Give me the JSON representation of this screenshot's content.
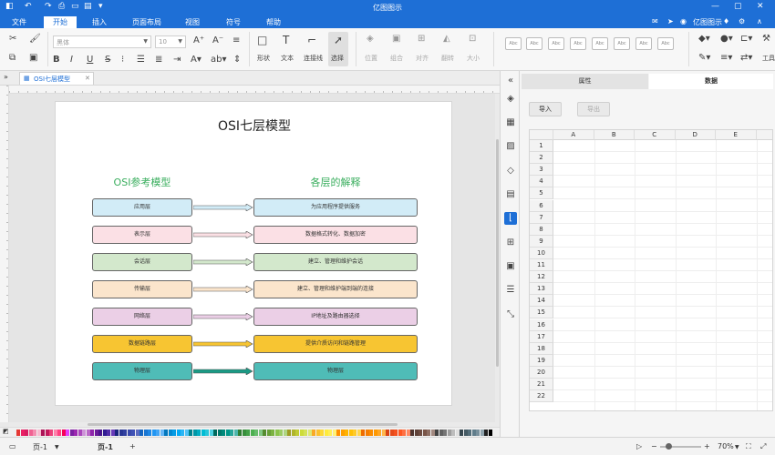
{
  "window": {
    "title": "亿图图示"
  },
  "menu": {
    "items": [
      "文件",
      "开始",
      "插入",
      "页面布局",
      "视图",
      "符号",
      "帮助"
    ],
    "active_index": 1
  },
  "account": {
    "name": "亿图图示"
  },
  "ribbon": {
    "font_name": "黑体",
    "font_size": "10",
    "tools": {
      "shape": "形状",
      "text": "文本",
      "connector": "连接线",
      "select": "选择"
    },
    "arrange": {
      "position": "位置",
      "group": "组合",
      "align": "对齐",
      "flip": "翻转",
      "size": "大小"
    },
    "style_sample": "Abc",
    "tools_group": "工具"
  },
  "document": {
    "tab_label": "OSI七层模型"
  },
  "diagram": {
    "title": "OSI七层模型",
    "left_header": "OSI参考模型",
    "right_header": "各层的解释",
    "rows": [
      {
        "layer": "应用层",
        "desc": "为应用程序提供服务",
        "fill": "#d2ecf7",
        "arrow": "#d2ecf7"
      },
      {
        "layer": "表示层",
        "desc": "数据格式转化、数据加密",
        "fill": "#fbe0e5",
        "arrow": "#fbe0e5"
      },
      {
        "layer": "会话层",
        "desc": "建立、管理和维护会话",
        "fill": "#d3e8cc",
        "arrow": "#d3e8cc"
      },
      {
        "layer": "传输层",
        "desc": "建立、管理和维护端到端的连接",
        "fill": "#fbe5cc",
        "arrow": "#fbe5cc"
      },
      {
        "layer": "网络层",
        "desc": "IP地址及路由器选择",
        "fill": "#ebcfe6",
        "arrow": "#ebcfe6"
      },
      {
        "layer": "数据链路层",
        "desc": "提供介质访问和链路管理",
        "fill": "#f7c532",
        "arrow": "#f7c532"
      },
      {
        "layer": "物理层",
        "desc": "物理层",
        "fill": "#4fbcb7",
        "arrow": "#1a9a85"
      }
    ]
  },
  "panel": {
    "tabs": [
      "属性",
      "数据"
    ],
    "active_tab": 1,
    "import_label": "导入",
    "export_label": "导出",
    "columns": [
      "A",
      "B",
      "C",
      "D",
      "E",
      "F"
    ],
    "rows": [
      "1",
      "2",
      "3",
      "4",
      "5",
      "6",
      "7",
      "8",
      "9",
      "10",
      "11",
      "12",
      "13",
      "14",
      "15",
      "16",
      "17",
      "18",
      "19",
      "20",
      "21",
      "22"
    ]
  },
  "status": {
    "page_selector": "页-1",
    "page_tab": "页-1",
    "add_page": "+",
    "zoom": "70%"
  },
  "palette_colors": [
    "#e53935",
    "#e91e63",
    "#d81b60",
    "#f06292",
    "#f48fb1",
    "#f8bbd0",
    "#ad1457",
    "#c2185b",
    "#ec407a",
    "#ff80ab",
    "#ff4081",
    "#f50057",
    "#e040fb",
    "#7b1fa2",
    "#9c27b0",
    "#ab47bc",
    "#ce93d8",
    "#ba68c8",
    "#8e24aa",
    "#6a1b9a",
    "#4a148c",
    "#311b92",
    "#512da8",
    "#673ab7",
    "#1a237e",
    "#283593",
    "#303f9f",
    "#3949ab",
    "#3f51b5",
    "#5c6bc0",
    "#1565c0",
    "#1976d2",
    "#1e88e5",
    "#2196f3",
    "#42a5f5",
    "#64b5f6",
    "#0277bd",
    "#0288d1",
    "#039be5",
    "#03a9f4",
    "#29b6f6",
    "#4fc3f7",
    "#00838f",
    "#0097a7",
    "#00acc1",
    "#00bcd4",
    "#26c6da",
    "#4dd0e1",
    "#00695c",
    "#00796b",
    "#00897b",
    "#009688",
    "#26a69a",
    "#4db6ac",
    "#2e7d32",
    "#388e3c",
    "#43a047",
    "#4caf50",
    "#66bb6a",
    "#81c784",
    "#558b2f",
    "#689f38",
    "#7cb342",
    "#8bc34a",
    "#9ccc65",
    "#aed581",
    "#9e9d24",
    "#afb42b",
    "#c0ca33",
    "#cddc39",
    "#d4e157",
    "#dce775",
    "#f9a825",
    "#fbc02d",
    "#fdd835",
    "#ffeb3b",
    "#ffee58",
    "#fff176",
    "#ff8f00",
    "#ffa000",
    "#ffb300",
    "#ffc107",
    "#ffca28",
    "#ffd54f",
    "#ef6c00",
    "#f57c00",
    "#fb8c00",
    "#ff9800",
    "#ffa726",
    "#ffb74d",
    "#d84315",
    "#e64a19",
    "#f4511e",
    "#ff5722",
    "#ff7043",
    "#ff8a65",
    "#4e342e",
    "#5d4037",
    "#6d4c41",
    "#795548",
    "#8d6e63",
    "#a1887f",
    "#424242",
    "#616161",
    "#757575",
    "#9e9e9e",
    "#bdbdbd",
    "#e0e0e0",
    "#37474f",
    "#455a64",
    "#546e7a",
    "#607d8b",
    "#78909c",
    "#90a4ae",
    "#212121",
    "#000000"
  ]
}
